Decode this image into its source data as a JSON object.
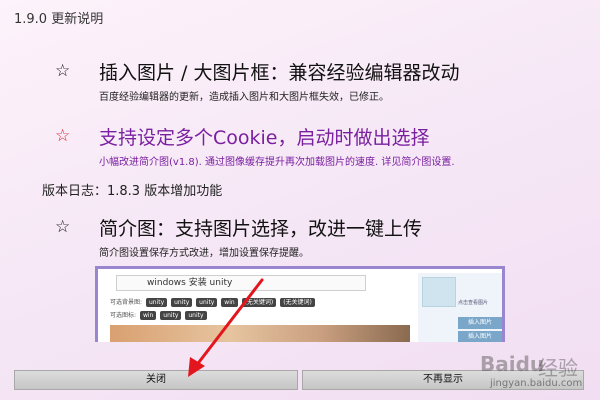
{
  "dialog": {
    "title": "1.9.0 更新说明"
  },
  "features": [
    {
      "star": "☆",
      "heading": "插入图片 / 大图片框：兼容经验编辑器改动",
      "desc": "百度经验编辑器的更新，造成插入图片和大图片框失效，已修正。"
    },
    {
      "star": "☆",
      "heading": "支持设定多个Cookie，启动时做出选择",
      "desc": "小幅改进简介图(v1.8). 通过图像缓存提升再次加载图片的速度. 详见简介图设置."
    },
    {
      "star": "☆",
      "heading": "简介图：支持图片选择，改进一键上传",
      "desc": "简介图设置保存方式改进，增加设置保存提醒。"
    }
  ],
  "changelog": {
    "text": "版本日志：1.8.3 版本增加功能"
  },
  "screenshot": {
    "search_value": "windows 安装 unity",
    "row1_label": "可选背景图:",
    "row1_chips": [
      "unity",
      "unity",
      "unity",
      "win",
      "(无关键词)",
      "(无关键词)"
    ],
    "row2_label": "可选图标:",
    "row2_chips": [
      "win",
      "unity",
      "unity"
    ],
    "side_caption": "点击查看图片",
    "side_btn1": "插入图片",
    "side_btn2": "插入图片"
  },
  "buttons": {
    "close": "关闭",
    "dont_show": "不再显示"
  },
  "watermark": {
    "logo": "Baidu",
    "cn": "经验",
    "url": "jingyan.baidu.com"
  },
  "colors": {
    "star_red": "#e0202a",
    "highlight_purple": "#7a1fa0",
    "frame_border": "#9a86cf"
  }
}
